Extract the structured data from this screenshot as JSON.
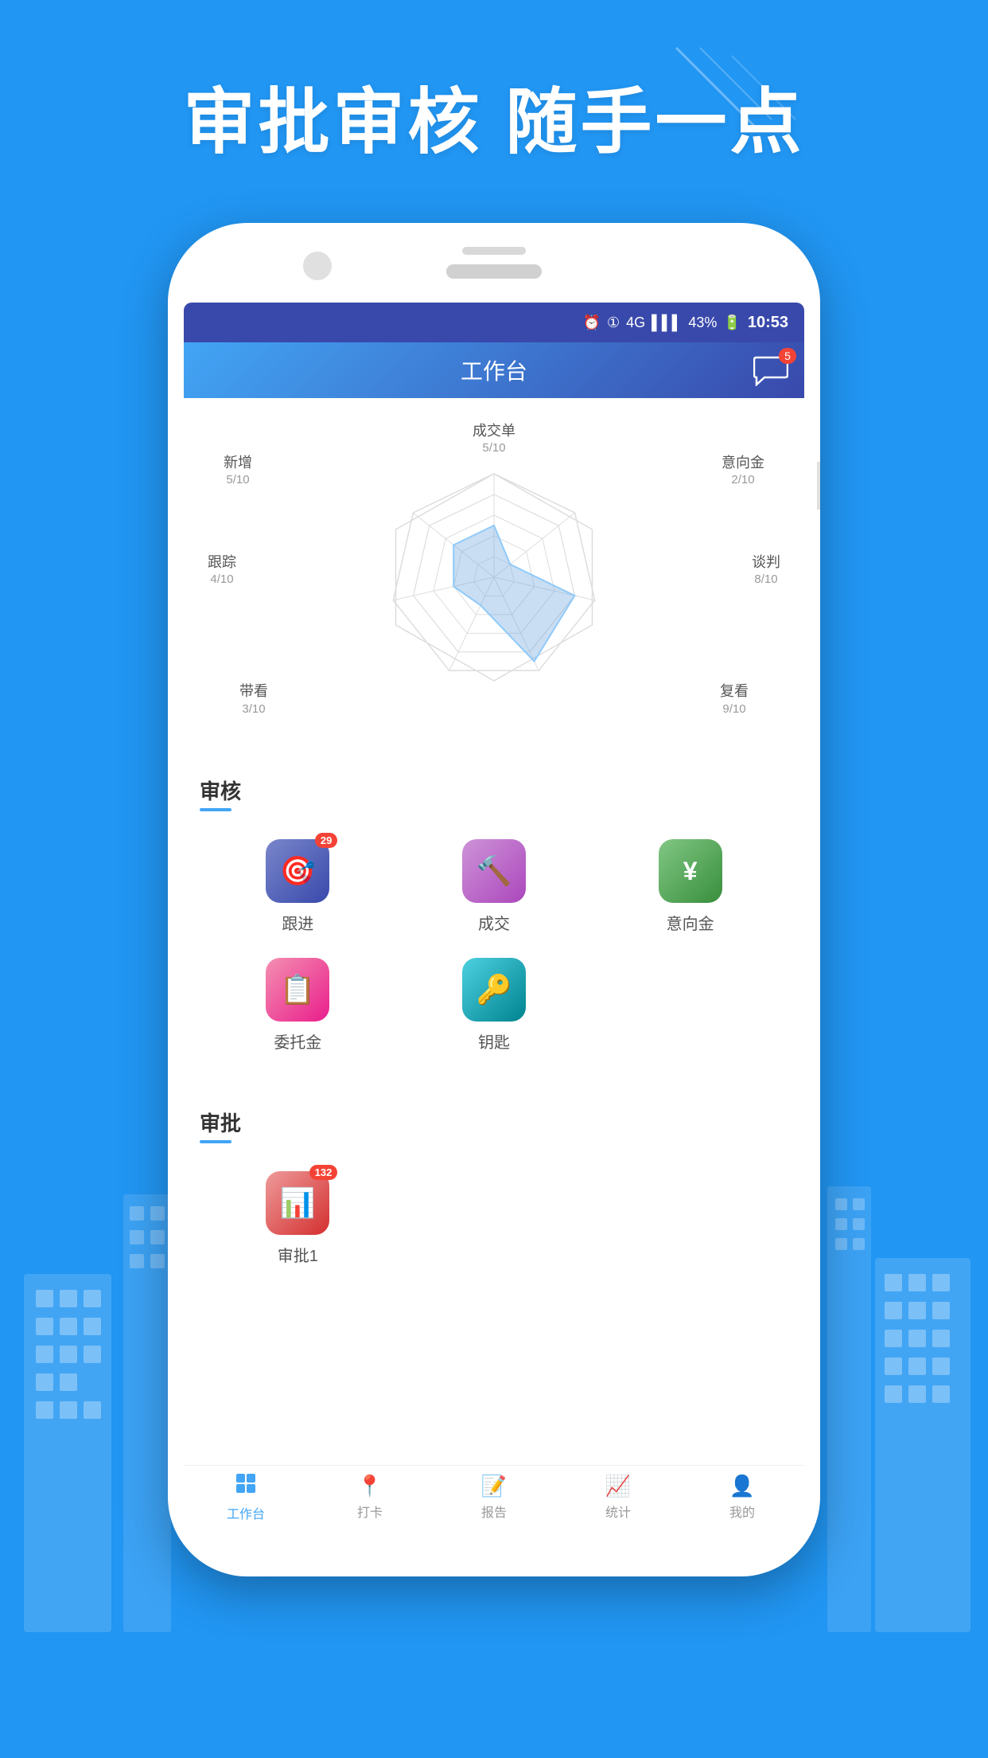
{
  "hero": {
    "text": "审批审核 随手一点"
  },
  "statusBar": {
    "battery": "43%",
    "time": "10:53",
    "network": "4G"
  },
  "header": {
    "title": "工作台",
    "messageBadge": "5"
  },
  "radar": {
    "labels": [
      {
        "id": "top",
        "name": "成交单",
        "value": "5/10"
      },
      {
        "id": "topRight",
        "name": "意向金",
        "value": "2/10"
      },
      {
        "id": "right",
        "name": "谈判",
        "value": "8/10"
      },
      {
        "id": "bottomRight",
        "name": "复看",
        "value": "9/10"
      },
      {
        "id": "bottomLeft",
        "name": "带看",
        "value": "3/10"
      },
      {
        "id": "left",
        "name": "跟踪",
        "value": "4/10"
      },
      {
        "id": "topLeft",
        "name": "新增",
        "value": "5/10"
      }
    ]
  },
  "auditSection": {
    "title": "审核",
    "items": [
      {
        "id": "genjin",
        "label": "跟进",
        "badge": "29",
        "bg": "#5C6BC0",
        "icon": "⊙"
      },
      {
        "id": "chengjiao",
        "label": "成交",
        "badge": "",
        "bg": "#BA68C8",
        "icon": "🔨"
      },
      {
        "id": "yixiangjin",
        "label": "意向金",
        "badge": "",
        "bg": "#66BB6A",
        "icon": "¥"
      },
      {
        "id": "weituojin",
        "label": "委托金",
        "badge": "",
        "bg": "#EC407A",
        "icon": "📋"
      },
      {
        "id": "yaoshi",
        "label": "钥匙",
        "badge": "",
        "bg": "#26C6DA",
        "icon": "🔑"
      }
    ]
  },
  "approvalSection": {
    "title": "审批",
    "items": [
      {
        "id": "approval1",
        "label": "审批1",
        "badge": "132",
        "bg": "#EF5350",
        "icon": "📊"
      }
    ]
  },
  "bottomNav": {
    "items": [
      {
        "id": "worktable",
        "label": "工作台",
        "icon": "⊞",
        "active": true
      },
      {
        "id": "checkin",
        "label": "打卡",
        "icon": "📍",
        "active": false
      },
      {
        "id": "report",
        "label": "报告",
        "icon": "📝",
        "active": false
      },
      {
        "id": "stats",
        "label": "统计",
        "icon": "📈",
        "active": false
      },
      {
        "id": "mine",
        "label": "我的",
        "icon": "👤",
        "active": false
      }
    ]
  }
}
